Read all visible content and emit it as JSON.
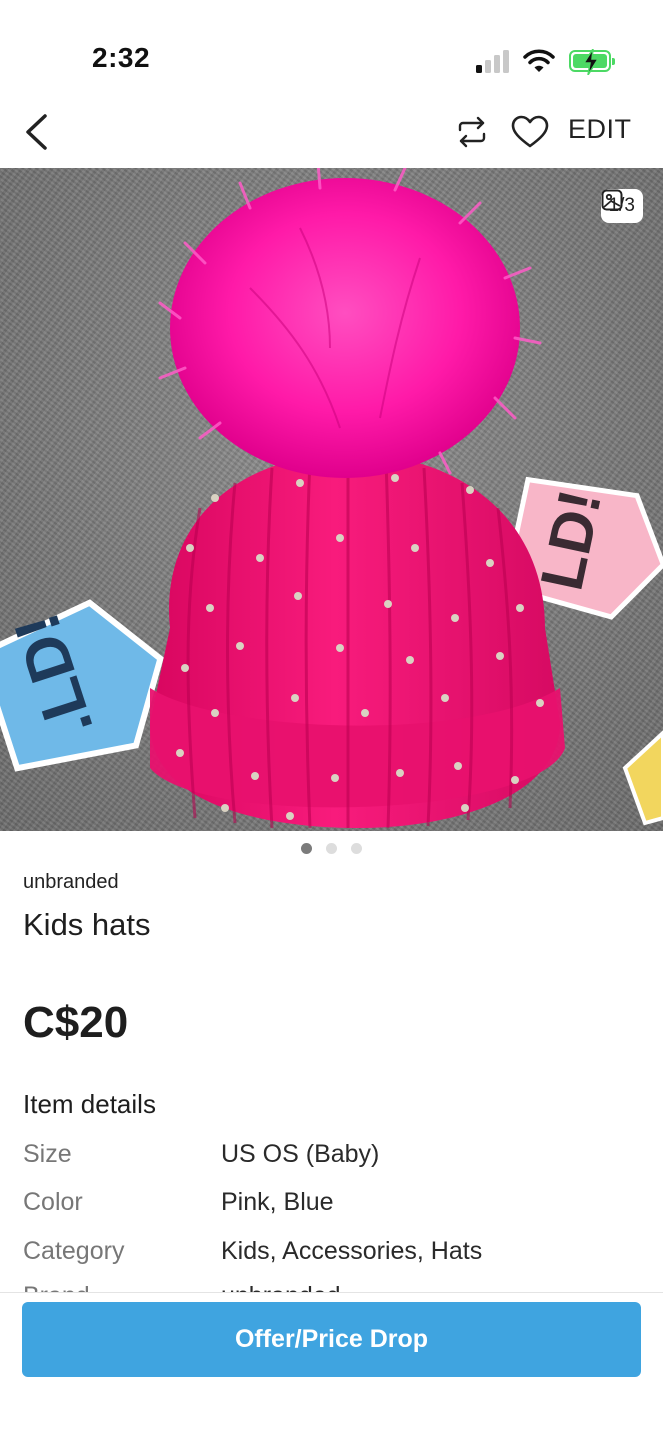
{
  "status_bar": {
    "time": "2:32"
  },
  "nav": {
    "edit_label": "EDIT"
  },
  "image": {
    "counter": "1/3",
    "current_index": 1,
    "total_images": 3
  },
  "listing": {
    "brand": "unbranded",
    "title": "Kids hats",
    "price": "C$20"
  },
  "item_details": {
    "heading": "Item details",
    "rows": [
      {
        "label": "Size",
        "value": "US OS (Baby)"
      },
      {
        "label": "Color",
        "value": "Pink, Blue"
      },
      {
        "label": "Category",
        "value": "Kids, Accessories, Hats"
      },
      {
        "label": "Brand",
        "value": "unbranded"
      }
    ]
  },
  "actions": {
    "offer_label": "Offer/Price Drop"
  },
  "colors": {
    "accent": "#3fa4e0",
    "battery_green": "#4cd964",
    "hat_pink": "#f0167a",
    "pompom_pink": "#ff1aa8"
  }
}
